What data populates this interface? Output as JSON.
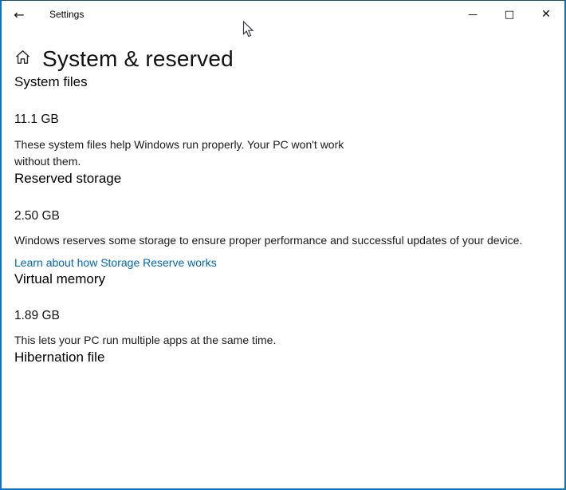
{
  "window": {
    "title": "Settings",
    "icons": {
      "back": "←",
      "minimize": "—",
      "maximize": "□",
      "close": "✕"
    }
  },
  "page": {
    "title": "System & reserved"
  },
  "sections": [
    {
      "heading": "System files",
      "value": "11.1 GB",
      "description": "These system files help Windows run properly. Your PC won't work\nwithout them."
    },
    {
      "heading": "Reserved storage",
      "value": "2.50 GB",
      "description": "Windows reserves some storage to ensure proper performance and successful updates of your device.",
      "link": "Learn about how Storage Reserve works"
    },
    {
      "heading": "Virtual memory",
      "value": "1.89 GB",
      "description": "This lets your PC run multiple apps at the same time."
    },
    {
      "heading": "Hibernation file"
    }
  ],
  "colors": {
    "window_border_side": "#0b76bb",
    "window_border_top": "#1a4a6e",
    "link": "#0067b8",
    "background": "#ffffff",
    "text": "#000000"
  }
}
